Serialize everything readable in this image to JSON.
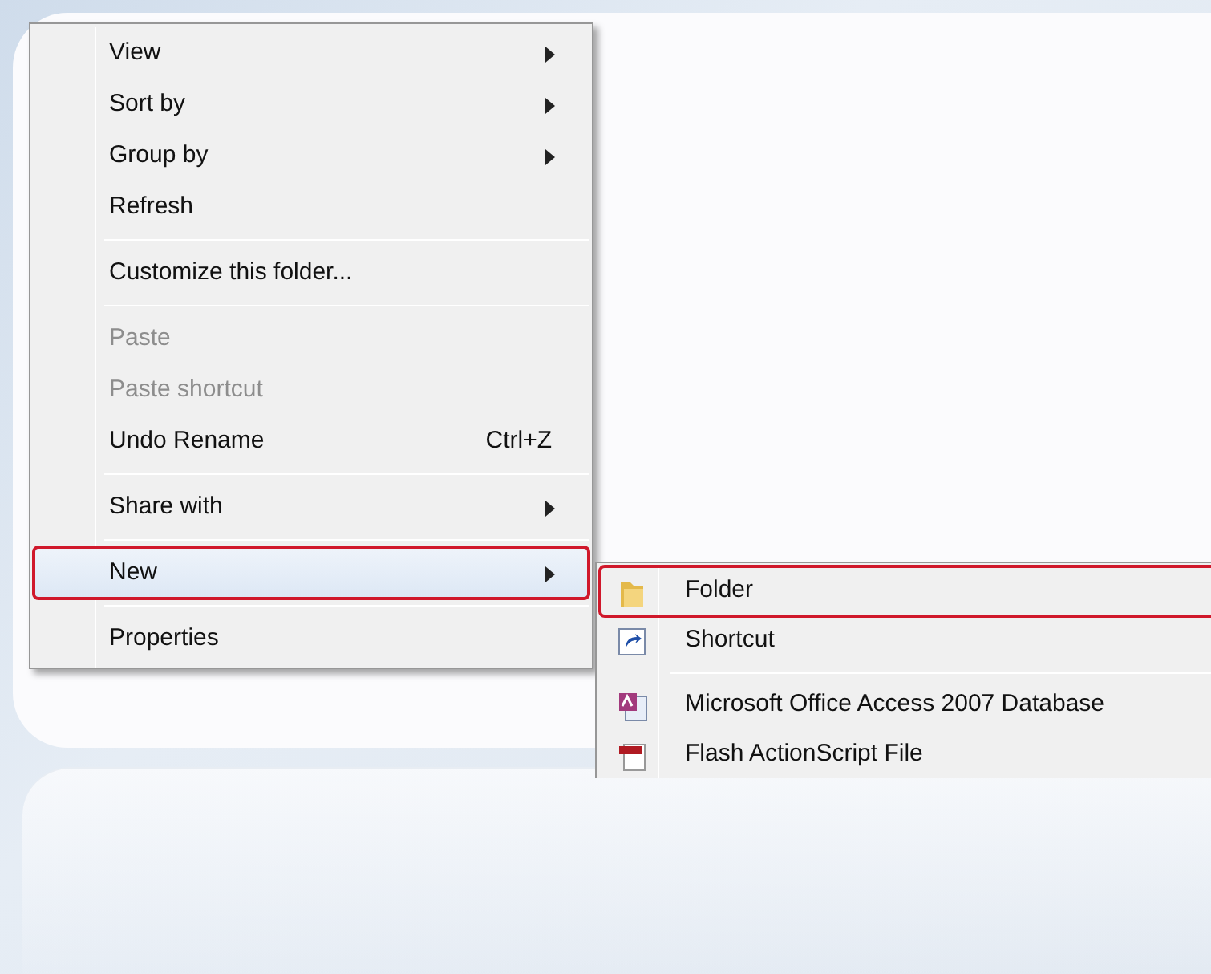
{
  "context_menu": {
    "items": [
      {
        "kind": "item",
        "label": "View",
        "submenu": true,
        "disabled": false,
        "selected": false,
        "marked": false
      },
      {
        "kind": "item",
        "label": "Sort by",
        "submenu": true,
        "disabled": false,
        "selected": false,
        "marked": false
      },
      {
        "kind": "item",
        "label": "Group by",
        "submenu": true,
        "disabled": false,
        "selected": false,
        "marked": false
      },
      {
        "kind": "item",
        "label": "Refresh",
        "submenu": false,
        "disabled": false,
        "selected": false,
        "marked": false
      },
      {
        "kind": "separator"
      },
      {
        "kind": "item",
        "label": "Customize this folder...",
        "submenu": false,
        "disabled": false,
        "selected": false,
        "marked": false
      },
      {
        "kind": "separator"
      },
      {
        "kind": "item",
        "label": "Paste",
        "submenu": false,
        "disabled": true,
        "selected": false,
        "marked": false
      },
      {
        "kind": "item",
        "label": "Paste shortcut",
        "submenu": false,
        "disabled": true,
        "selected": false,
        "marked": false
      },
      {
        "kind": "item",
        "label": "Undo Rename",
        "shortcut": "Ctrl+Z",
        "submenu": false,
        "disabled": false,
        "selected": false,
        "marked": false
      },
      {
        "kind": "separator"
      },
      {
        "kind": "item",
        "label": "Share with",
        "submenu": true,
        "disabled": false,
        "selected": false,
        "marked": false
      },
      {
        "kind": "separator"
      },
      {
        "kind": "item",
        "label": "New",
        "submenu": true,
        "disabled": false,
        "selected": true,
        "marked": true
      },
      {
        "kind": "separator"
      },
      {
        "kind": "item",
        "label": "Properties",
        "submenu": false,
        "disabled": false,
        "selected": false,
        "marked": false
      }
    ]
  },
  "new_submenu": {
    "items": [
      {
        "kind": "folder",
        "label": "Folder",
        "marked": true
      },
      {
        "kind": "shortcut",
        "label": "Shortcut",
        "marked": false
      },
      {
        "kind": "separator"
      },
      {
        "kind": "database",
        "label": "Microsoft Office Access 2007 Database",
        "marked": false
      },
      {
        "kind": "flash-file",
        "label": "Flash ActionScript File",
        "marked": false
      }
    ]
  }
}
